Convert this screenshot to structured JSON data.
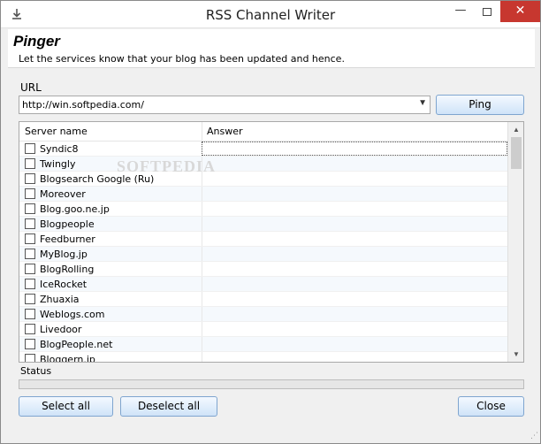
{
  "window": {
    "title": "RSS Channel Writer",
    "minimize": "—",
    "close": "✕"
  },
  "header": {
    "title": "Pinger",
    "description": "Let the services know that your blog has been updated and hence."
  },
  "url": {
    "label": "URL",
    "value": "http://win.softpedia.com/"
  },
  "buttons": {
    "ping": "Ping",
    "select_all": "Select all",
    "deselect_all": "Deselect all",
    "close": "Close"
  },
  "list": {
    "columns": [
      "Server name",
      "Answer"
    ],
    "rows": [
      {
        "name": "Syndic8",
        "answer": "",
        "checked": false
      },
      {
        "name": "Twingly",
        "answer": "",
        "checked": false
      },
      {
        "name": "Blogsearch Google (Ru)",
        "answer": "",
        "checked": false
      },
      {
        "name": "Moreover",
        "answer": "",
        "checked": false
      },
      {
        "name": "Blog.goo.ne.jp",
        "answer": "",
        "checked": false
      },
      {
        "name": "Blogpeople",
        "answer": "",
        "checked": false
      },
      {
        "name": "Feedburner",
        "answer": "",
        "checked": false
      },
      {
        "name": "MyBlog.jp",
        "answer": "",
        "checked": false
      },
      {
        "name": "BlogRolling",
        "answer": "",
        "checked": false
      },
      {
        "name": "IceRocket",
        "answer": "",
        "checked": false
      },
      {
        "name": "Zhuaxia",
        "answer": "",
        "checked": false
      },
      {
        "name": "Weblogs.com",
        "answer": "",
        "checked": false
      },
      {
        "name": "Livedoor",
        "answer": "",
        "checked": false
      },
      {
        "name": "BlogPeople.net",
        "answer": "",
        "checked": false
      },
      {
        "name": "Bloggern.jp",
        "answer": "",
        "checked": false
      }
    ],
    "watermark": "SOFTPEDIA"
  },
  "status": {
    "label": "Status",
    "progress": 0
  },
  "colors": {
    "button_border": "#7fa5cf",
    "close_button": "#c7372f",
    "progress_fill": "#06b025"
  }
}
